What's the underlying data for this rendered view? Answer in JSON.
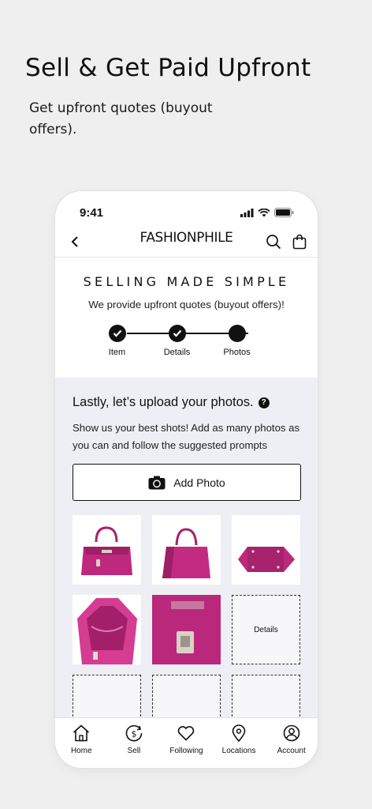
{
  "promo": {
    "headline": "Sell & Get Paid Upfront",
    "subline": "Get upfront quotes (buyout offers)."
  },
  "status": {
    "time": "9:41"
  },
  "nav": {
    "brand": "FASHIONPHILE",
    "icons": [
      "back-chevron-icon",
      "search-icon",
      "shopping-bag-icon"
    ]
  },
  "hero": {
    "title": "SELLING MADE SIMPLE",
    "subtitle": "We provide upfront quotes (buyout offers)!"
  },
  "steps": [
    {
      "label": "Item",
      "state": "done"
    },
    {
      "label": "Details",
      "state": "done"
    },
    {
      "label": "Photos",
      "state": "current"
    }
  ],
  "upload": {
    "title": "Lastly, let’s upload your photos.",
    "description": "Show us your best shots! Add as many photos as you can and follow the suggested prompts",
    "add_photo_label": "Add Photo",
    "slots": [
      {
        "type": "photo",
        "view": "front"
      },
      {
        "type": "photo",
        "view": "side"
      },
      {
        "type": "photo",
        "view": "bottom"
      },
      {
        "type": "photo",
        "view": "interior"
      },
      {
        "type": "photo",
        "view": "stamp-closeup"
      },
      {
        "type": "empty",
        "label": "Details"
      },
      {
        "type": "empty",
        "label": ""
      },
      {
        "type": "empty",
        "label": ""
      },
      {
        "type": "empty",
        "label": ""
      }
    ]
  },
  "tabs": [
    {
      "label": "Home",
      "icon": "home-icon"
    },
    {
      "label": "Sell",
      "icon": "dollar-circle-icon"
    },
    {
      "label": "Following",
      "icon": "heart-icon"
    },
    {
      "label": "Locations",
      "icon": "map-pin-icon"
    },
    {
      "label": "Account",
      "icon": "user-circle-icon"
    }
  ],
  "colors": {
    "bag": "#c0287e",
    "bag_dark": "#8e1c5d",
    "accent": "#111111",
    "section_bg": "#eeeff4"
  }
}
